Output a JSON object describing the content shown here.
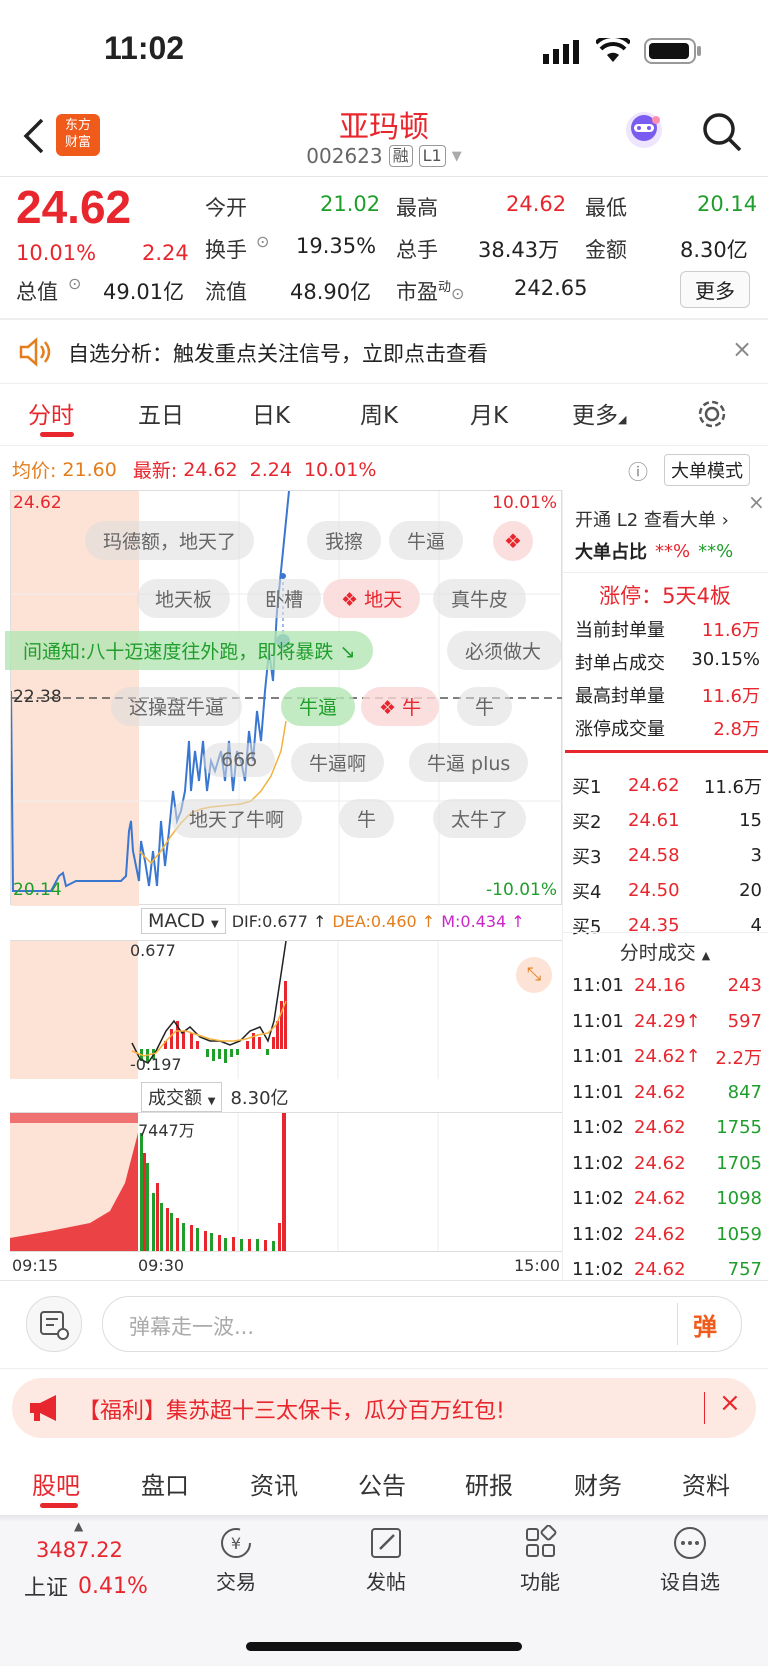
{
  "status_bar": {
    "time": "11:02"
  },
  "header": {
    "logo_line1": "东方",
    "logo_line2": "财富",
    "stock_name": "亚玛顿",
    "stock_code": "002623",
    "tag_rong": "融",
    "tag_l1": "L1"
  },
  "quote": {
    "price": "24.62",
    "change_pct": "10.01%",
    "change_amt": "2.24",
    "open_label": "今开",
    "open": "21.02",
    "high_label": "最高",
    "high": "24.62",
    "low_label": "最低",
    "low": "20.14",
    "turnover_label": "换手",
    "turnover": "19.35%",
    "volume_label": "总手",
    "volume": "38.43万",
    "amount_label": "金额",
    "amount": "8.30亿",
    "mktcap_label": "总值",
    "mktcap": "49.01亿",
    "float_label": "流值",
    "float": "48.90亿",
    "pe_label": "市盈",
    "pe_sup": "动",
    "pe": "242.65",
    "more_button": "更多"
  },
  "notice": {
    "text": "自选分析：触发重点关注信号，立即点击查看"
  },
  "tabs": [
    "分时",
    "五日",
    "日K",
    "周K",
    "月K",
    "更多"
  ],
  "chart_info": {
    "avg_label": "均价:",
    "avg": "21.60",
    "latest_label": "最新:",
    "latest": "24.62",
    "latest_chg": "2.24",
    "latest_pct": "10.01%",
    "big_order_mode": "大单模式",
    "top_left": "24.62",
    "top_right": "10.01%",
    "mid_left": "22.38",
    "bottom_left": "20.14",
    "bottom_right": "-10.01%",
    "scroll_text": "间通知:八十迈速度往外跑，即将暴跌"
  },
  "danmu": [
    "玛德额，地天了",
    "我擦",
    "牛逼",
    "地天板",
    "卧槽",
    "地天",
    "真牛皮",
    "必须做大",
    "这操盘牛逼",
    "牛逼",
    "牛",
    "牛",
    "666",
    "牛逼啊",
    "牛逼 plus",
    "地天了牛啊",
    "牛",
    "太牛了"
  ],
  "macd": {
    "label": "MACD",
    "dif": "DIF:0.677 ↑",
    "dea": "DEA:0.460 ↑",
    "m": "M:0.434 ↑",
    "top": "0.677",
    "bottom": "-0.197"
  },
  "volume_chart": {
    "label": "成交额",
    "total": "8.30亿",
    "max": "7447万",
    "t_start": "09:15",
    "t_mid": "09:30",
    "t_end": "15:00"
  },
  "right_panel": {
    "open_l2": "开通 L2 查看大单",
    "big_ratio_label": "大单占比",
    "big_ratio_red": "**%",
    "big_ratio_green": "**%",
    "limit_title": "涨停：5天4板",
    "stats": [
      {
        "label": "当前封单量",
        "value": "11.6万"
      },
      {
        "label": "封单占成交",
        "value": "30.15%"
      },
      {
        "label": "最高封单量",
        "value": "11.6万"
      },
      {
        "label": "涨停成交量",
        "value": "2.8万"
      }
    ],
    "bids": [
      {
        "label": "买1",
        "price": "24.62",
        "vol": "11.6万"
      },
      {
        "label": "买2",
        "price": "24.61",
        "vol": "15"
      },
      {
        "label": "买3",
        "price": "24.58",
        "vol": "3"
      },
      {
        "label": "买4",
        "price": "24.50",
        "vol": "20"
      },
      {
        "label": "买5",
        "price": "24.35",
        "vol": "4"
      }
    ],
    "ticks_title": "分时成交",
    "ticks": [
      {
        "time": "11:01",
        "price": "24.16",
        "vol": "243",
        "vol_color": "red"
      },
      {
        "time": "11:01",
        "price": "24.29↑",
        "vol": "597",
        "vol_color": "red"
      },
      {
        "time": "11:01",
        "price": "24.62↑",
        "vol": "2.2万",
        "vol_color": "red"
      },
      {
        "time": "11:01",
        "price": "24.62",
        "vol": "847",
        "vol_color": "green"
      },
      {
        "time": "11:02",
        "price": "24.62",
        "vol": "1755",
        "vol_color": "green"
      },
      {
        "time": "11:02",
        "price": "24.62",
        "vol": "1705",
        "vol_color": "green"
      },
      {
        "time": "11:02",
        "price": "24.62",
        "vol": "1098",
        "vol_color": "green"
      },
      {
        "time": "11:02",
        "price": "24.62",
        "vol": "1059",
        "vol_color": "green"
      },
      {
        "time": "11:02",
        "price": "24.62",
        "vol": "757",
        "vol_color": "green"
      }
    ]
  },
  "comment": {
    "placeholder": "弹幕走一波...",
    "send_icon_text": "弹"
  },
  "promo": {
    "text": "【福利】集苏超十三太保卡，瓜分百万红包!"
  },
  "bottom_tabs": [
    "股吧",
    "盘口",
    "资讯",
    "公告",
    "研报",
    "财务",
    "资料"
  ],
  "bottom_nav": {
    "index_value": "3487.22",
    "index_name": "上证",
    "index_pct": "0.41%",
    "items": [
      "交易",
      "发帖",
      "功能",
      "设自选"
    ]
  }
}
